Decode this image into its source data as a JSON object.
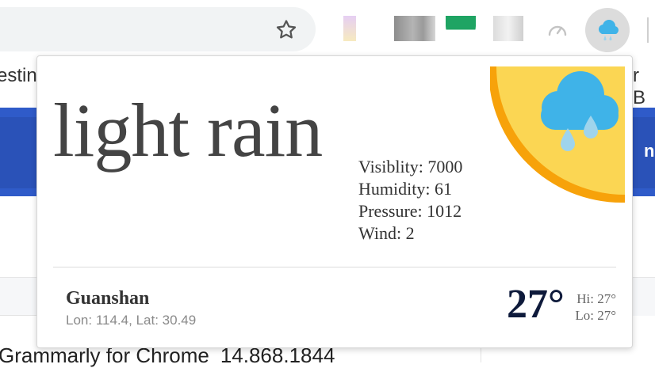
{
  "colors": {
    "sun_fill": "#fbd653",
    "sun_ring": "#f7a20a",
    "cloud": "#3fb3e8",
    "rain_drop": "#9fd4ec",
    "temperature_text": "#0e1a3b",
    "page_banner": "#2f5bc9"
  },
  "toolbar": {
    "bookmark_icon": "star-icon",
    "speed_icon": "speedometer-icon",
    "weather_extension_icon": "rain-cloud-icon"
  },
  "page": {
    "bookmark_left_fragment": "esting",
    "bookmark_right_fragment": "r B",
    "banner_fragment": "nod",
    "list_item": {
      "name": "Grammarly for Chrome",
      "version": "14.868.1844"
    }
  },
  "weather": {
    "condition": "light rain",
    "icon": "rain-cloud-on-sun-icon",
    "stats": [
      {
        "label": "Visiblity",
        "value": "7000"
      },
      {
        "label": "Humidity",
        "value": "61"
      },
      {
        "label": "Pressure",
        "value": "1012"
      },
      {
        "label": "Wind",
        "value": "2"
      }
    ],
    "city": "Guanshan",
    "coords": {
      "lon_label": "Lon",
      "lon": "114.4",
      "lat_label": "Lat",
      "lat": "30.49"
    },
    "temperature": "27°",
    "hi_label": "Hi",
    "hi": "27°",
    "lo_label": "Lo",
    "lo": "27°"
  }
}
